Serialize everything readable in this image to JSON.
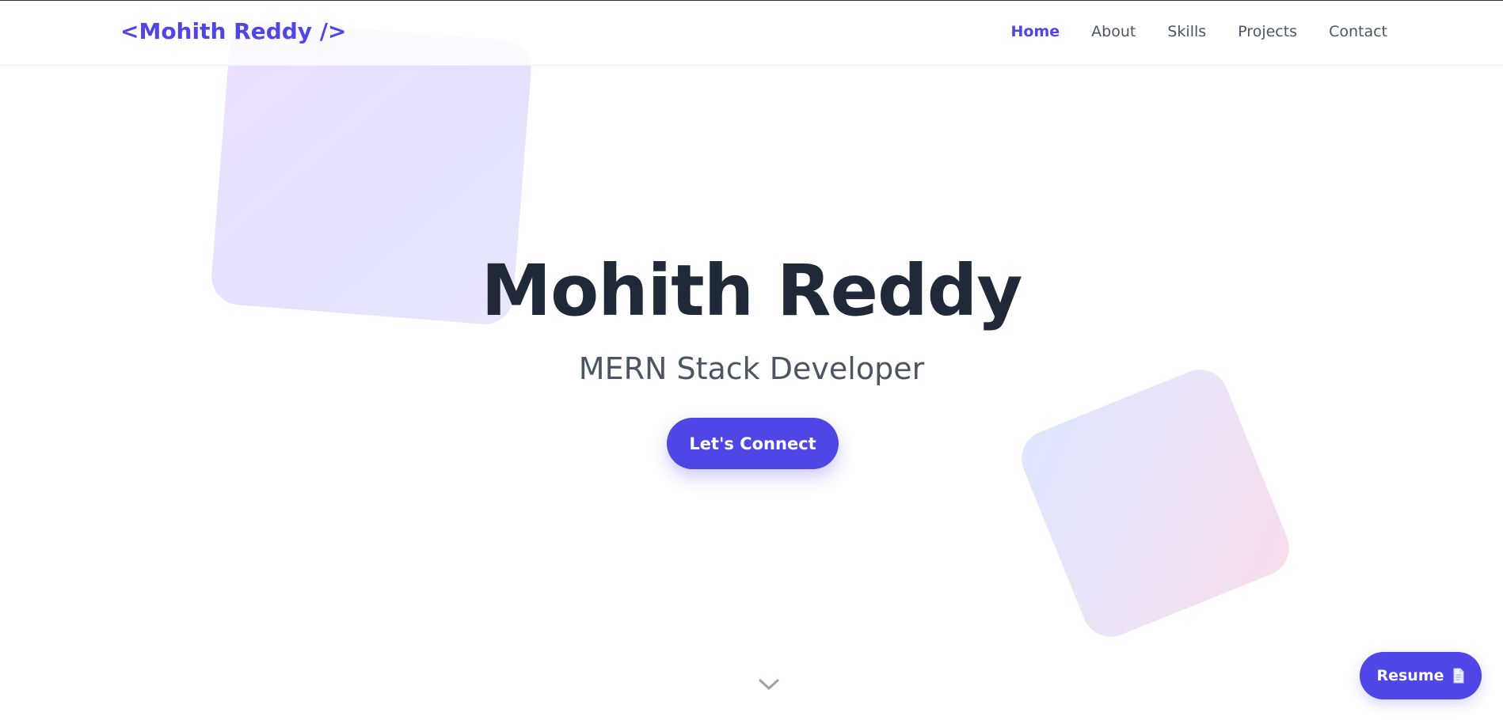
{
  "header": {
    "logo": "<Mohith Reddy />",
    "nav": [
      {
        "label": "Home",
        "active": true
      },
      {
        "label": "About",
        "active": false
      },
      {
        "label": "Skills",
        "active": false
      },
      {
        "label": "Projects",
        "active": false
      },
      {
        "label": "Contact",
        "active": false
      }
    ]
  },
  "hero": {
    "title": "Mohith Reddy",
    "subtitle": "MERN Stack Developer",
    "cta_label": "Let's Connect",
    "scroll_icon": "chevron-down-icon"
  },
  "floating": {
    "resume_label": "Resume",
    "resume_icon": "document-icon"
  },
  "colors": {
    "accent": "#4f46e5",
    "heading": "#1f2937",
    "body_text": "#4b5563",
    "background": "#ffffff"
  }
}
